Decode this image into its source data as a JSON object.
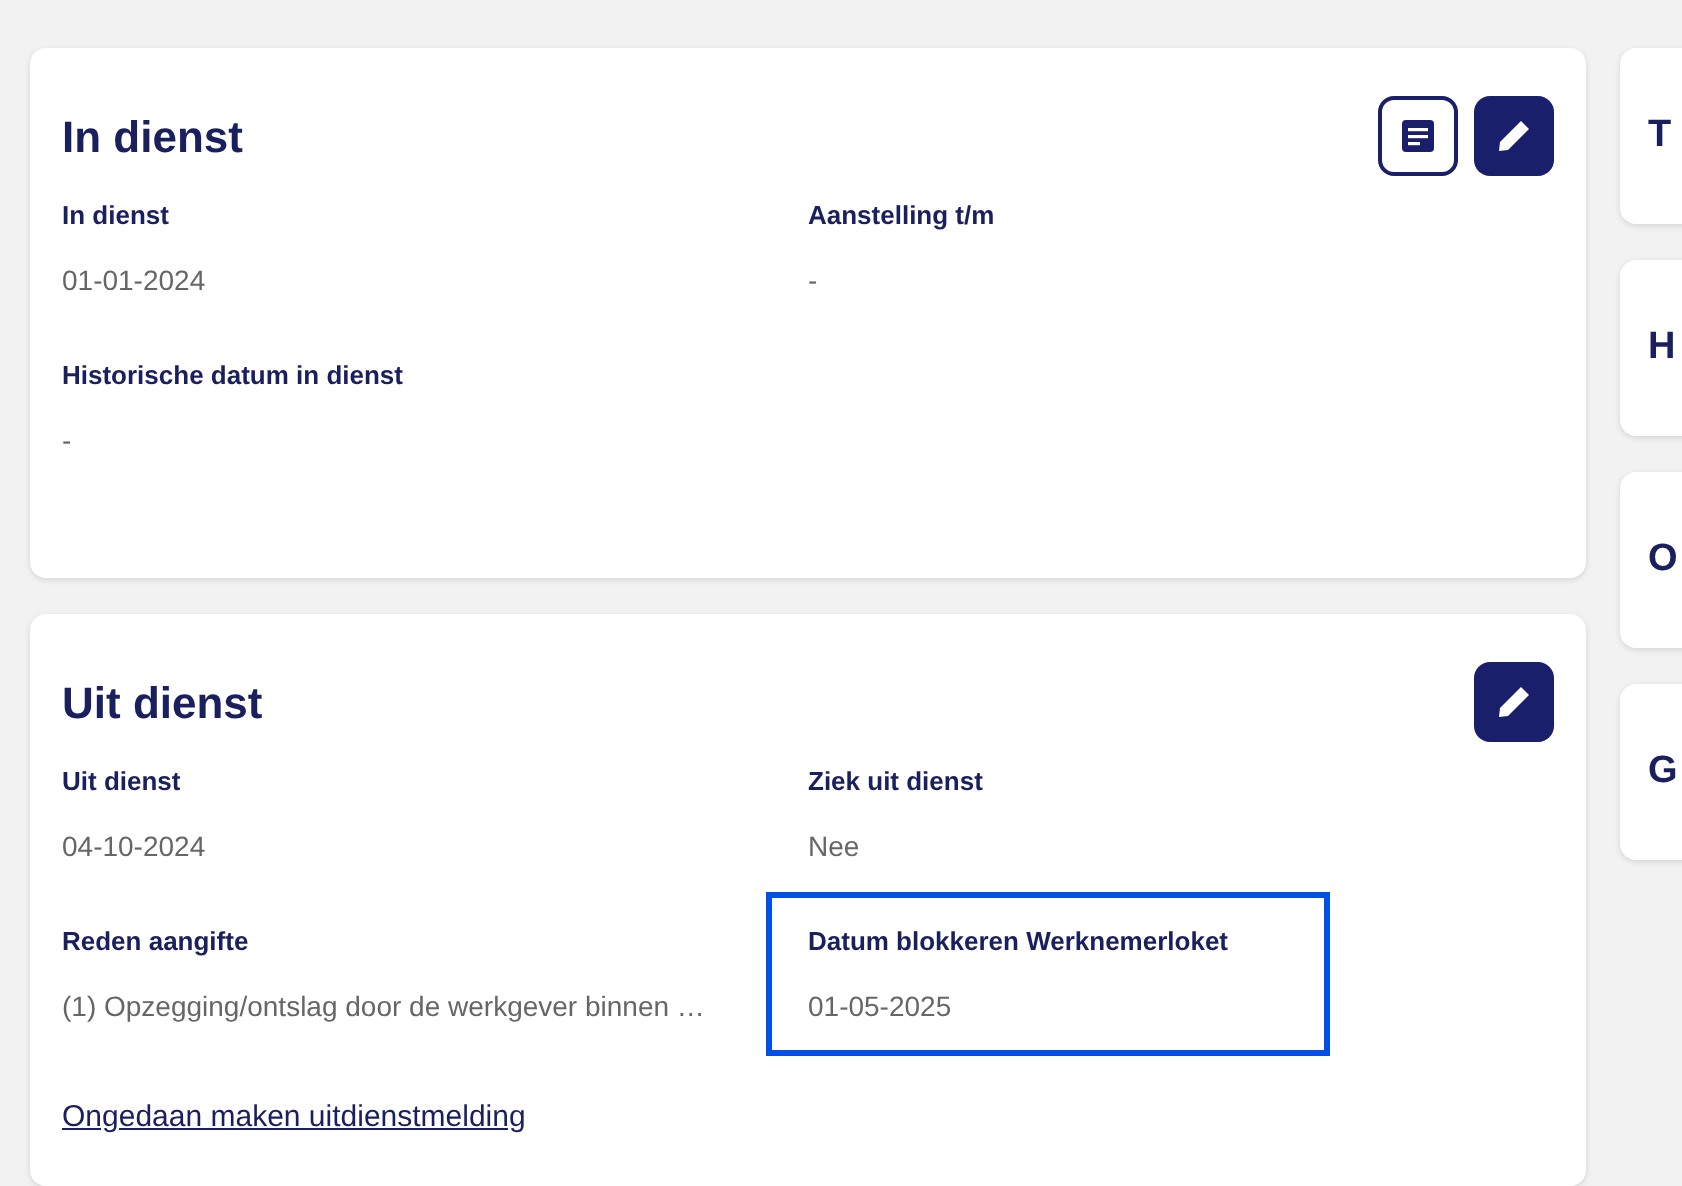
{
  "cards": [
    {
      "title": "In dienst",
      "actions": [
        {
          "kind": "document"
        },
        {
          "kind": "edit"
        }
      ],
      "fields": [
        {
          "label": "In dienst",
          "value": "01-01-2024",
          "highlighted": false
        },
        {
          "label": "Aanstelling t/m",
          "value": "-",
          "highlighted": false
        },
        {
          "label": "Historische datum in dienst",
          "value": "-",
          "highlighted": false
        }
      ]
    },
    {
      "title": "Uit dienst",
      "actions": [
        {
          "kind": "edit"
        }
      ],
      "fields": [
        {
          "label": "Uit dienst",
          "value": "04-10-2024",
          "highlighted": false
        },
        {
          "label": "Ziek uit dienst",
          "value": "Nee",
          "highlighted": false
        },
        {
          "label": "Reden aangifte",
          "value": "(1) Opzegging/ontslag door de werkgever binnen …",
          "highlighted": false
        },
        {
          "label": "Datum blokkeren Werknemerloket",
          "value": "01-05-2025",
          "highlighted": true
        }
      ],
      "link": "Ongedaan maken uitdienstmelding"
    }
  ],
  "side_cards": [
    {
      "title": "T"
    },
    {
      "title": "H"
    },
    {
      "title": "O"
    },
    {
      "title": "G"
    }
  ]
}
